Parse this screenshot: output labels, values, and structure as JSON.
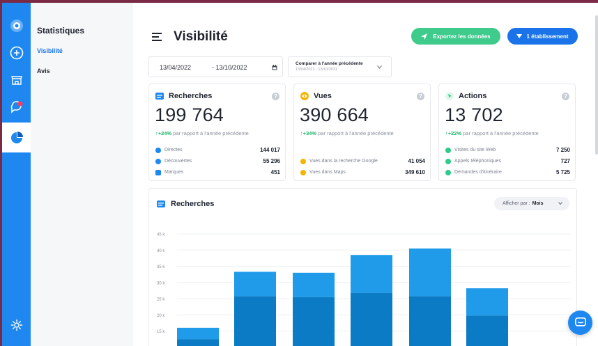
{
  "subnav": {
    "title": "Statistiques",
    "items": [
      {
        "label": "Visibilité",
        "active": true
      },
      {
        "label": "Avis",
        "active": false
      }
    ]
  },
  "header": {
    "title": "Visibilité",
    "export_label": "Exportez les données",
    "establishments_label": "1 établissement"
  },
  "filters": {
    "date_start": "13/04/2022",
    "date_end": "- 13/10/2022",
    "compare_title": "Comparer à l'année précédente",
    "compare_range": "13/04/2021 - 13/10/2021"
  },
  "cards": [
    {
      "title": "Recherches",
      "icon": "search-icon",
      "total": "199 764",
      "delta": "+24%",
      "delta_text": " par rapport à l'année précédente",
      "metrics": [
        {
          "label": "Directes",
          "value": "144 017",
          "color": "#1e88f0"
        },
        {
          "label": "Découvertes",
          "value": "55 296",
          "color": "#1e88f0"
        },
        {
          "label": "Marques",
          "value": "451",
          "color": "#1e88f0"
        }
      ]
    },
    {
      "title": "Vues",
      "icon": "eye-icon",
      "total": "390 664",
      "delta": "+34%",
      "delta_text": " par rapport à l'année précédente",
      "metrics": [
        {
          "label": "Vues dans la recherche Google",
          "value": "41 054",
          "color": "#f5b400"
        },
        {
          "label": "Vues dans Maps",
          "value": "349 610",
          "color": "#f5b400"
        }
      ]
    },
    {
      "title": "Actions",
      "icon": "cursor-icon",
      "total": "13 702",
      "delta": "+22%",
      "delta_text": " par rapport à l'année précédente",
      "metrics": [
        {
          "label": "Visites du site Web",
          "value": "7 250",
          "color": "#2ecc8a"
        },
        {
          "label": "Appels téléphoniques",
          "value": "727",
          "color": "#2ecc8a"
        },
        {
          "label": "Demandes d'itinéraire",
          "value": "5 725",
          "color": "#2ecc8a"
        }
      ]
    }
  ],
  "chart": {
    "title": "Recherches",
    "view_label": "Afficher par :",
    "view_value": "Mois"
  },
  "chart_data": {
    "type": "bar",
    "title": "Recherches",
    "stacked": true,
    "y_ticks": [
      "45 k",
      "40 k",
      "35 k",
      "30 k",
      "25 k",
      "20 k",
      "15 k",
      "10 k"
    ],
    "ylim": [
      10000,
      45000
    ],
    "series": [
      {
        "color": "#0a7bc4",
        "values": [
          12500,
          25800,
          25500,
          26800,
          25800,
          19800
        ]
      },
      {
        "color": "#1f9bea",
        "values": [
          3500,
          7500,
          7500,
          11700,
          14700,
          8400
        ]
      }
    ],
    "grid": true
  },
  "colors": {
    "rail": "#1e88f0",
    "accent": "#1a73e8",
    "export": "#3ecb8c",
    "positive": "#19b36b"
  }
}
